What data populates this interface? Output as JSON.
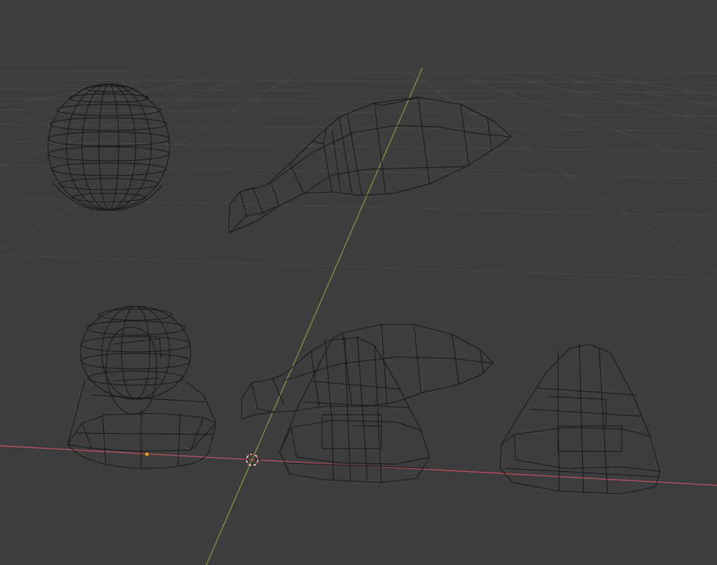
{
  "viewport": {
    "mode": "wireframe",
    "background": "#3d3d3d",
    "grid_color": "#4a4a4a",
    "x_axis_color": "#c9545f",
    "y_axis_color": "#7da23a",
    "wire_color": "#161616",
    "origin_marker": "3d-cursor",
    "selected_origin_color": "#f09a1b"
  },
  "objects": [
    {
      "name": "uv-sphere",
      "type": "mesh"
    },
    {
      "name": "fish-upper",
      "type": "mesh"
    },
    {
      "name": "pawn-sphere-cone",
      "type": "mesh",
      "selected": true
    },
    {
      "name": "fish-lower",
      "type": "mesh"
    },
    {
      "name": "cone-middle",
      "type": "mesh"
    },
    {
      "name": "cone-right",
      "type": "mesh"
    }
  ]
}
